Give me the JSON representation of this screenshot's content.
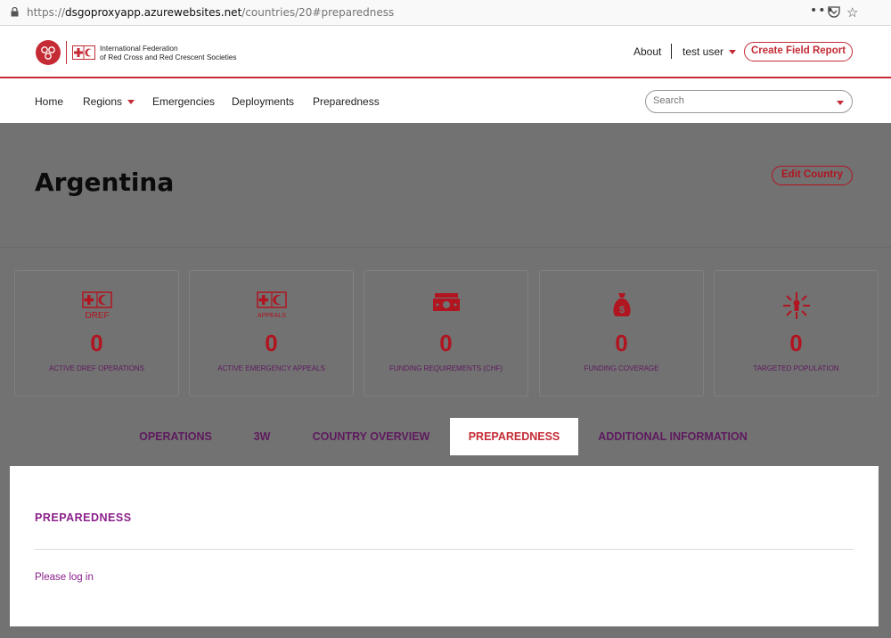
{
  "browser": {
    "url_scheme": "https://",
    "url_host": "dsgoproxyapp.azurewebsites.net",
    "url_path": "/countries/20#preparedness",
    "menu_dots": "•••"
  },
  "header": {
    "logo_line1": "International Federation",
    "logo_line2": "of Red Cross and Red Crescent Societies",
    "about": "About",
    "user": "test user",
    "create_field_report": "Create Field Report",
    "brand_color": "#c42b35"
  },
  "nav": {
    "items": [
      "Home",
      "Regions",
      "Emergencies",
      "Deployments",
      "Preparedness"
    ],
    "search_placeholder": "Search"
  },
  "page": {
    "country": "Argentina",
    "edit_country": "Edit Country"
  },
  "stats": [
    {
      "icon": "dref-icon",
      "sublabel": "DREF",
      "value": "0",
      "label": "ACTIVE DREF OPERATIONS"
    },
    {
      "icon": "appeals-icon",
      "sublabel": "APPEALS",
      "value": "0",
      "label": "ACTIVE EMERGENCY APPEALS"
    },
    {
      "icon": "money-icon",
      "sublabel": "",
      "value": "0",
      "label": "FUNDING REQUIREMENTS (CHF)"
    },
    {
      "icon": "money-bag-icon",
      "sublabel": "",
      "value": "0",
      "label": "FUNDING COVERAGE"
    },
    {
      "icon": "targeted-population-icon",
      "sublabel": "",
      "value": "0",
      "label": "TARGETED POPULATION"
    }
  ],
  "tabs": [
    {
      "label": "OPERATIONS",
      "active": false
    },
    {
      "label": "3W",
      "active": false
    },
    {
      "label": "COUNTRY OVERVIEW",
      "active": false
    },
    {
      "label": "PREPAREDNESS",
      "active": true
    },
    {
      "label": "ADDITIONAL INFORMATION",
      "active": false
    }
  ],
  "panel": {
    "title": "PREPAREDNESS",
    "login_text": "Please log in"
  }
}
